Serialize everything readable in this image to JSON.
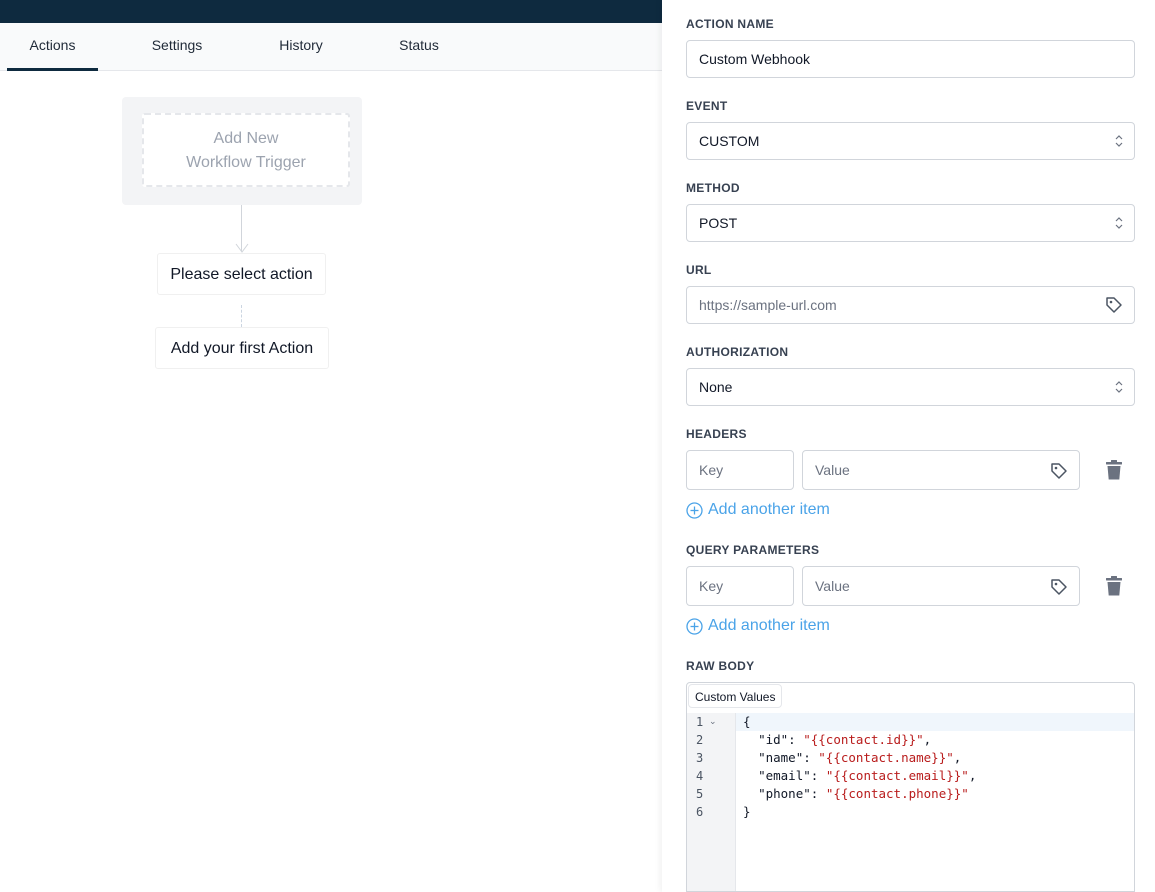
{
  "tabs": [
    "Actions",
    "Settings",
    "History",
    "Status"
  ],
  "canvas": {
    "trigger": "Add New\nWorkflow Trigger",
    "trigger_line1": "Add New",
    "trigger_line2": "Workflow Trigger",
    "select_action": "Please select action",
    "first_action": "Add your first Action"
  },
  "panel": {
    "action_name_label": "ACTION NAME",
    "action_name_value": "Custom Webhook",
    "event_label": "EVENT",
    "event_value": "CUSTOM",
    "method_label": "METHOD",
    "method_value": "POST",
    "url_label": "URL",
    "url_placeholder": "https://sample-url.com",
    "authorization_label": "AUTHORIZATION",
    "authorization_value": "None",
    "headers_label": "HEADERS",
    "headers_key_placeholder": "Key",
    "headers_value_placeholder": "Value",
    "headers_add": "Add another item",
    "query_label": "QUERY PARAMETERS",
    "query_key_placeholder": "Key",
    "query_value_placeholder": "Value",
    "query_add": "Add another item",
    "raw_body_label": "RAW BODY",
    "custom_values_button": "Custom Values",
    "code_lines": [
      {
        "n": "1",
        "text": "{"
      },
      {
        "n": "2",
        "key": "\"id\"",
        "val": "\"{{contact.id}}\"",
        "end": ","
      },
      {
        "n": "3",
        "key": "\"name\"",
        "val": "\"{{contact.name}}\"",
        "end": ","
      },
      {
        "n": "4",
        "key": "\"email\"",
        "val": "\"{{contact.email}}\"",
        "end": ","
      },
      {
        "n": "5",
        "key": "\"phone\"",
        "val": "\"{{contact.phone}}\"",
        "end": ""
      },
      {
        "n": "6",
        "text": "}"
      }
    ]
  },
  "colors": {
    "topbar": "#0e2a3f",
    "link_blue": "#4aa3e8",
    "code_string": "#b91c1c"
  }
}
